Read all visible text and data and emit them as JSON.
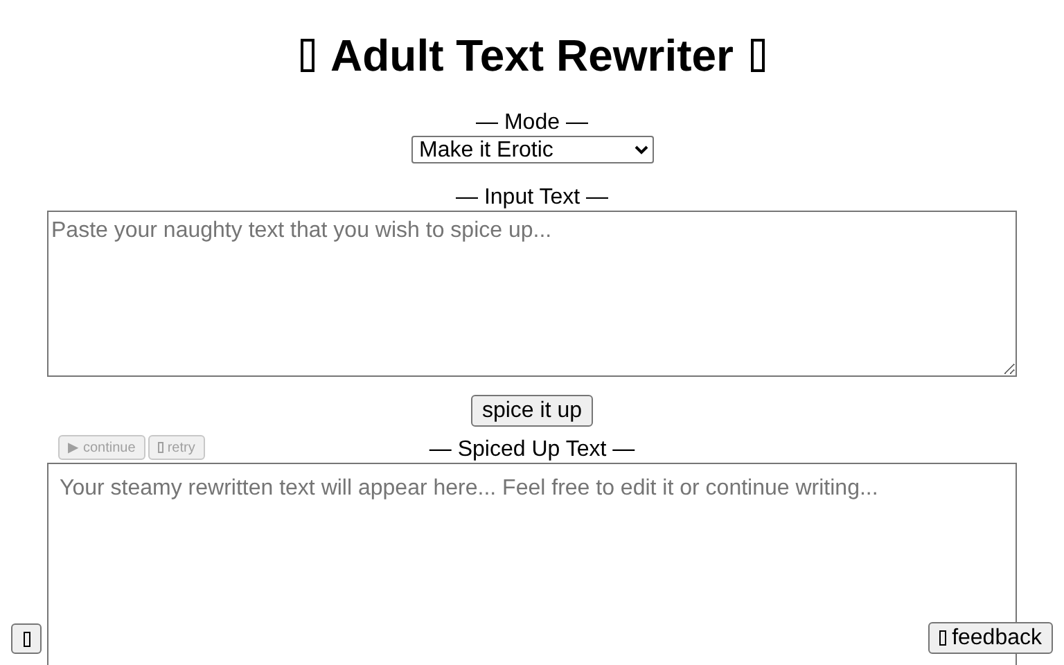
{
  "title": "Adult Text Rewriter",
  "mode": {
    "label": "— Mode —",
    "value": "Make it Erotic"
  },
  "input": {
    "label": "— Input Text —",
    "placeholder": "Paste your naughty text that you wish to spice up..."
  },
  "submit_button": "spice it up",
  "output": {
    "label": "— Spiced Up Text —",
    "placeholder": "Your steamy rewritten text will appear here... Feel free to edit it or continue writing..."
  },
  "output_actions": [
    {
      "kind": "continue",
      "icon_char": "▶",
      "label": "continue",
      "disabled": true
    },
    {
      "kind": "retry",
      "label": "retry",
      "disabled": true
    }
  ],
  "feedback_button": "feedback"
}
